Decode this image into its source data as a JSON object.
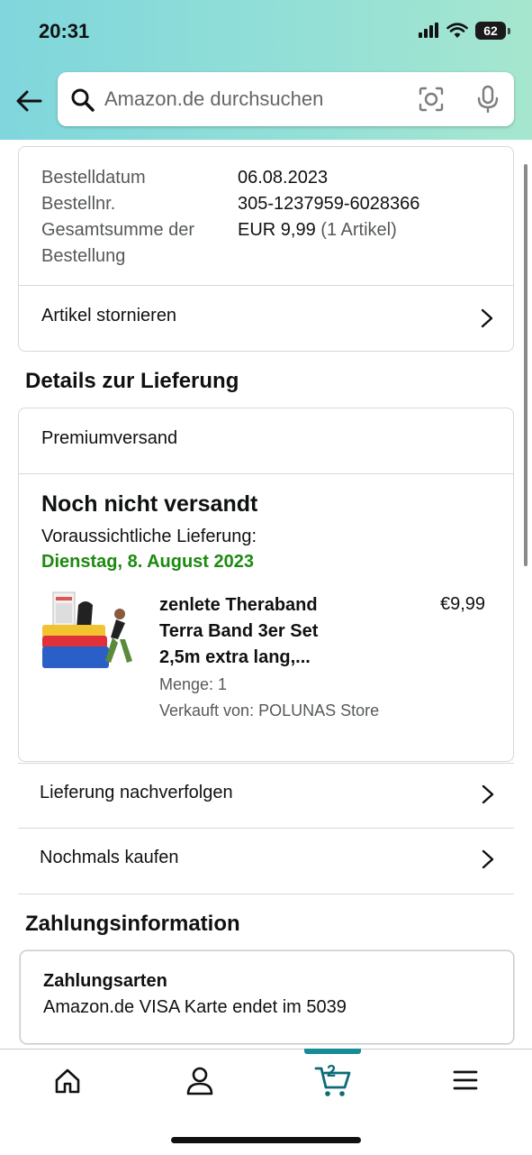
{
  "status_bar": {
    "time": "20:31",
    "battery": "62"
  },
  "search": {
    "placeholder": "Amazon.de durchsuchen"
  },
  "order_summary": {
    "rows": [
      {
        "label": "Bestelldatum",
        "value": "06.08.2023"
      },
      {
        "label": "Bestellnr.",
        "value": "305-1237959-6028366"
      }
    ],
    "total_label_line1": "Gesamtsumme der",
    "total_label_line2": "Bestellung",
    "total_value": "EUR 9,99",
    "total_count": "(1 Artikel)",
    "cancel_label": "Artikel stornieren"
  },
  "delivery": {
    "section_title": "Details zur Lieferung",
    "shipping_method": "Premiumversand",
    "status": "Noch nicht versandt",
    "estimate_label": "Voraussichtliche Lieferung:",
    "estimate_date": "Dienstag, 8. August 2023",
    "product": {
      "name_line1": "zenlete Theraband",
      "name_line2": "Terra Band 3er Set",
      "name_line3": "2,5m extra lang,...",
      "price": "€9,99",
      "quantity": "Menge: 1",
      "seller": "Verkauft von: POLUNAS Store"
    },
    "track_label": "Lieferung nachverfolgen",
    "buy_again_label": "Nochmals kaufen"
  },
  "payment": {
    "section_title": "Zahlungsinformation",
    "methods_title": "Zahlungsarten",
    "card_text": "Amazon.de VISA Karte",
    "card_ending": "endet im 5039"
  },
  "bottom_nav": {
    "cart_count": "2"
  },
  "colors": {
    "accent": "#178c98",
    "delivery_green": "#1c8a0f",
    "header_start": "#7fd6dc",
    "header_end": "#a6e6cf"
  },
  "icons": [
    "back-arrow-icon",
    "search-icon",
    "camera-icon",
    "mic-icon",
    "chevron-right-icon",
    "home-icon",
    "account-icon",
    "cart-icon",
    "menu-icon"
  ]
}
